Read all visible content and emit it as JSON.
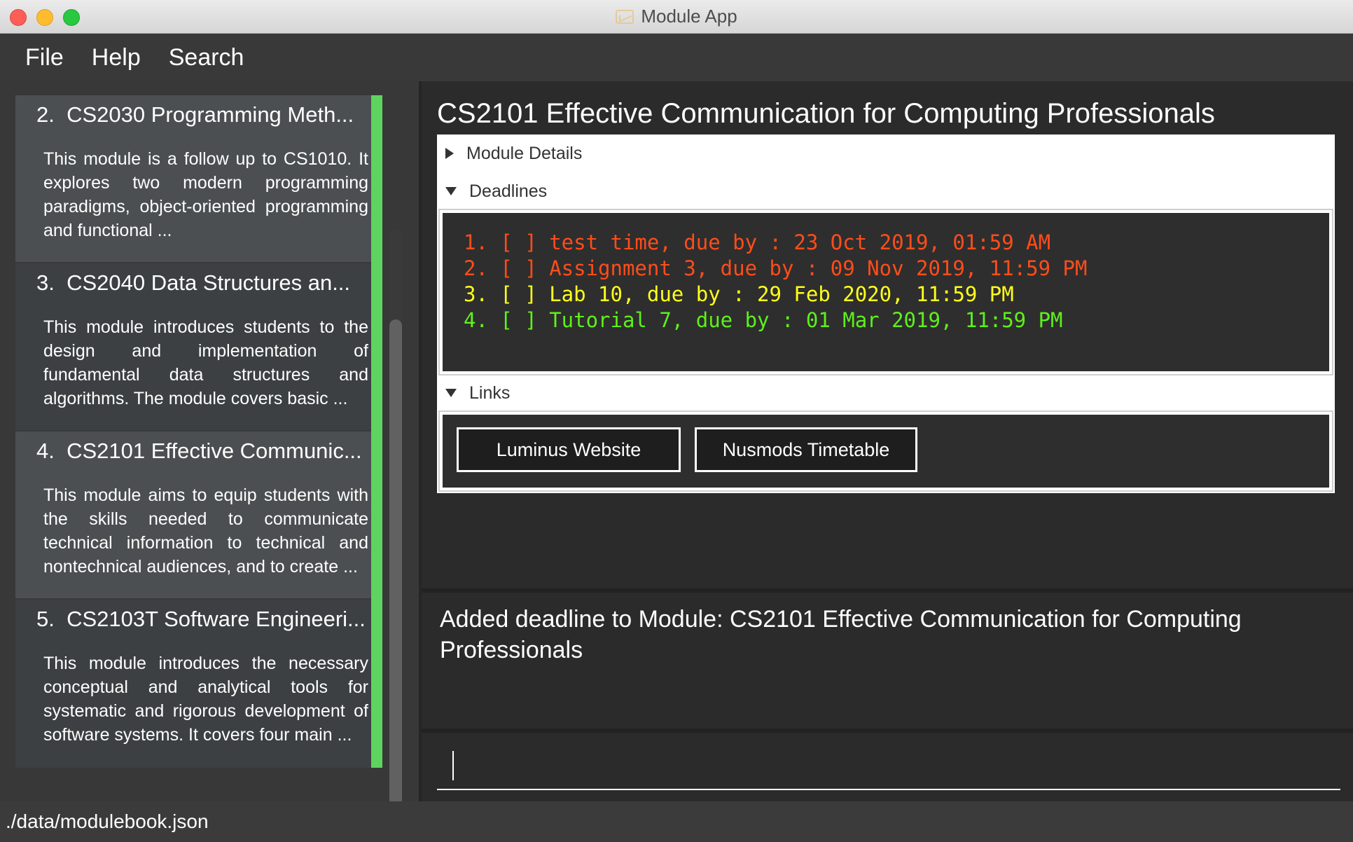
{
  "window": {
    "title": "Module App"
  },
  "menu": {
    "file": "File",
    "help": "Help",
    "search": "Search"
  },
  "modules": [
    {
      "index": "2.",
      "code_name": "CS2030 Programming Meth...",
      "description": "This module is a follow up to CS1010. It explores two modern programming paradigms, object-oriented programming and functional ..."
    },
    {
      "index": "3.",
      "code_name": "CS2040 Data Structures an...",
      "description": "This module introduces students to the design and implementation of fundamental data structures and algorithms. The module covers basic ..."
    },
    {
      "index": "4.",
      "code_name": "CS2101 Effective Communic...",
      "description": "This module aims to equip students with the skills needed to communicate technical information to technical and nontechnical audiences, and to create ..."
    },
    {
      "index": "5.",
      "code_name": "CS2103T Software Engineeri...",
      "description": "This module introduces the necessary conceptual and analytical tools for systematic and rigorous development of software systems. It covers four main ..."
    }
  ],
  "detail": {
    "title": "CS2101 Effective Communication for Computing Professionals",
    "module_details_label": "Module Details",
    "deadlines_label": "Deadlines",
    "links_label": "Links",
    "deadlines": [
      {
        "text": "1. [ ] test time, due by : 23 Oct 2019, 01:59 AM",
        "color": "#ff4d1a"
      },
      {
        "text": "2. [ ] Assignment 3, due by : 09 Nov 2019, 11:59 PM",
        "color": "#ff4d1a"
      },
      {
        "text": "3. [ ] Lab 10, due by : 29 Feb 2020, 11:59 PM",
        "color": "#ffff1a"
      },
      {
        "text": "4. [ ] Tutorial 7, due by : 01 Mar 2019, 11:59 PM",
        "color": "#5ff01a"
      }
    ],
    "links": {
      "luminus": "Luminus Website",
      "nusmods": "Nusmods Timetable"
    }
  },
  "result": {
    "text": "Added deadline to Module: CS2101 Effective Communication for Computing Professionals"
  },
  "command": {
    "value": ""
  },
  "status": {
    "path": "./data/modulebook.json"
  },
  "colors": {
    "accent_green": "#5fd35f",
    "background": "#2b2b2b"
  }
}
